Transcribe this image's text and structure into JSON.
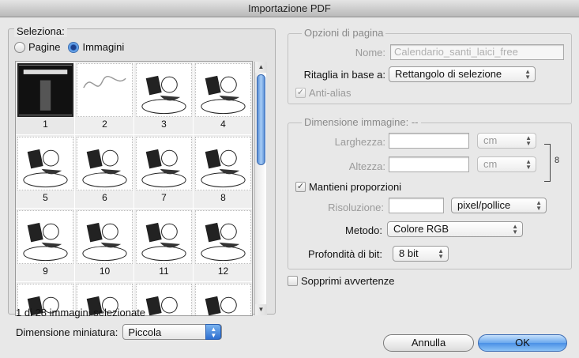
{
  "window": {
    "title": "Importazione PDF"
  },
  "select": {
    "legend": "Seleziona:",
    "radio_pages": "Pagine",
    "radio_images": "Immagini",
    "selected_mode": "Immagini"
  },
  "thumbnails": [
    {
      "num": "1",
      "selected": true
    },
    {
      "num": "2",
      "selected": false
    },
    {
      "num": "3",
      "selected": false
    },
    {
      "num": "4",
      "selected": false
    },
    {
      "num": "5",
      "selected": false
    },
    {
      "num": "6",
      "selected": false
    },
    {
      "num": "7",
      "selected": false
    },
    {
      "num": "8",
      "selected": false
    },
    {
      "num": "9",
      "selected": false
    },
    {
      "num": "10",
      "selected": false
    },
    {
      "num": "11",
      "selected": false
    },
    {
      "num": "12",
      "selected": false
    },
    {
      "num": "",
      "selected": false
    },
    {
      "num": "",
      "selected": false
    },
    {
      "num": "",
      "selected": false
    },
    {
      "num": "",
      "selected": false
    }
  ],
  "status": "1 di 28 immagini selezionate",
  "thumb_size": {
    "label": "Dimensione miniatura:",
    "value": "Piccola"
  },
  "page_options": {
    "legend": "Opzioni di pagina",
    "name_label": "Nome:",
    "name_value": "Calendario_santi_laici_free",
    "crop_label": "Ritaglia in base a:",
    "crop_value": "Rettangolo di selezione",
    "antialias_label": "Anti-alias"
  },
  "image_size": {
    "legend": "Dimensione immagine: --",
    "width_label": "Larghezza:",
    "width_value": "",
    "width_unit": "cm",
    "height_label": "Altezza:",
    "height_value": "",
    "height_unit": "cm",
    "constrain_label": "Mantieni proporzioni",
    "resolution_label": "Risoluzione:",
    "resolution_value": "",
    "resolution_unit": "pixel/pollice",
    "mode_label": "Metodo:",
    "mode_value": "Colore RGB",
    "depth_label": "Profondità di bit:",
    "depth_value": "8 bit"
  },
  "suppress_label": "Sopprimi avvertenze",
  "buttons": {
    "cancel": "Annulla",
    "ok": "OK"
  },
  "colors": {
    "accent": "#4a90e6",
    "selection_border": "#222222"
  }
}
